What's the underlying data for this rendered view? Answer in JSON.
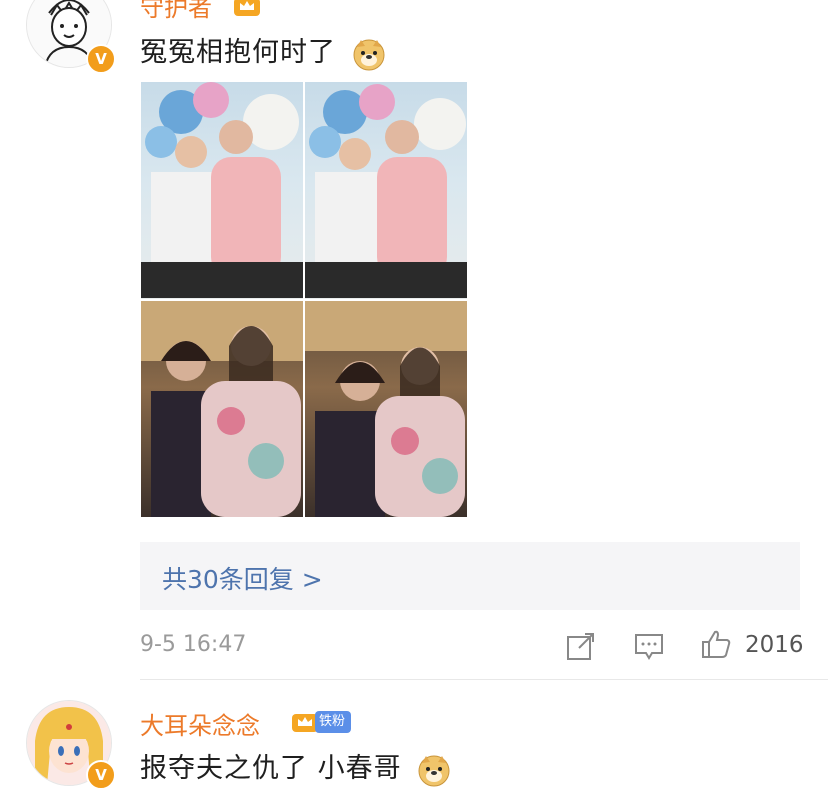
{
  "comments": [
    {
      "username": "守护者",
      "verified_badge": "V",
      "text": "冤冤相抱何时了",
      "emoji": "doge-emoji",
      "replies_link": "共30条回复 >",
      "timestamp": "9-5 16:47",
      "like_count": "2016"
    },
    {
      "username": "大耳朵念念",
      "verified_badge": "V",
      "fan_badge": "铁粉",
      "text": "报夺夫之仇了 小春哥",
      "emoji": "doge-emoji"
    }
  ],
  "icons": {
    "share": "share-icon",
    "comment": "comment-icon",
    "like": "thumbs-up-icon"
  },
  "colors": {
    "username": "#ec7a2a",
    "link": "#4e74ad",
    "badge": "#f29d1b",
    "fan_badge": "#5b8fe8"
  }
}
